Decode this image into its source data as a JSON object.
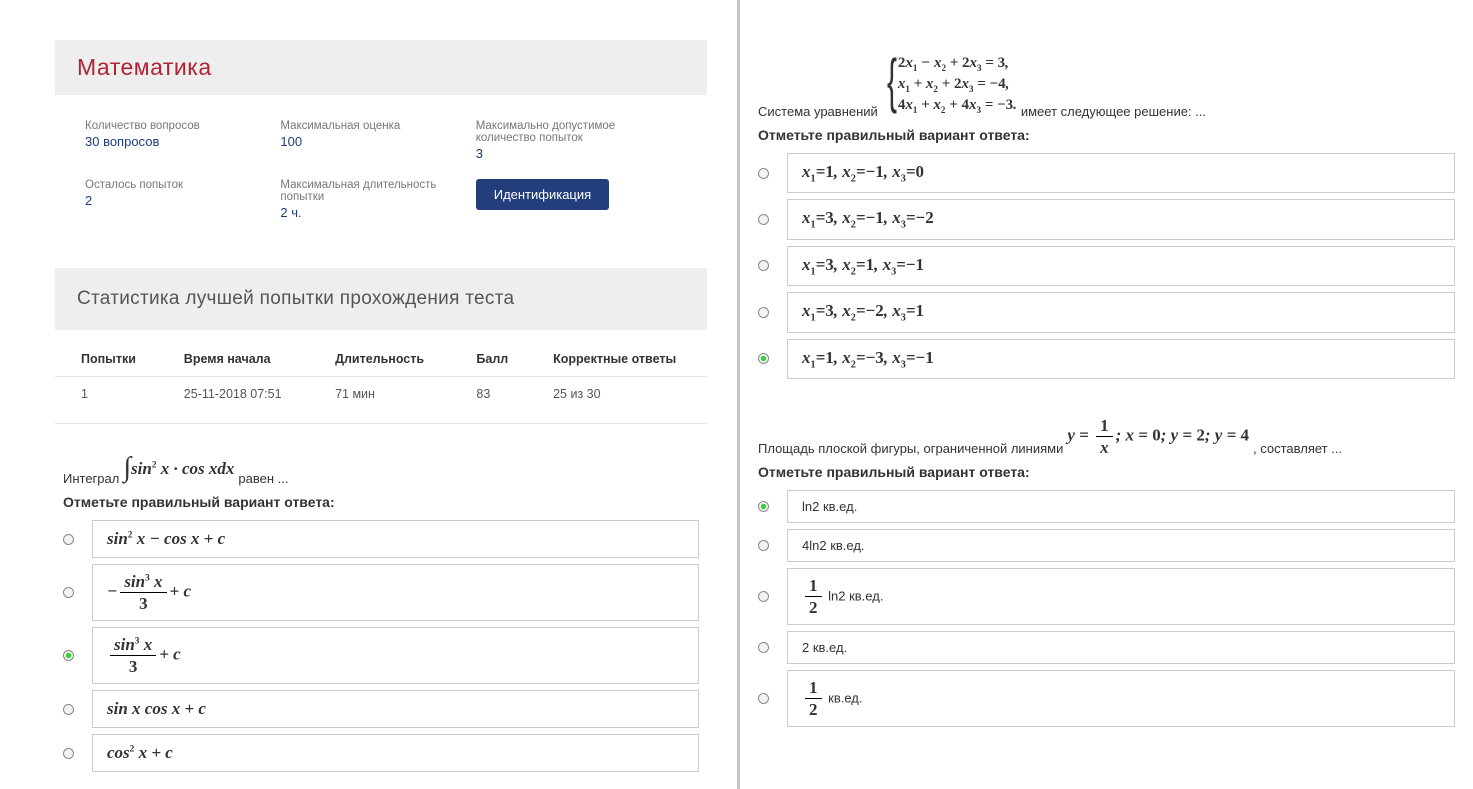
{
  "left": {
    "title": "Математика",
    "info": {
      "questions_label": "Количество вопросов",
      "questions_value": "30 вопросов",
      "maxscore_label": "Максимальная оценка",
      "maxscore_value": "100",
      "maxattempts_label": "Максимально допустимое количество попыток",
      "maxattempts_value": "3",
      "attemptsleft_label": "Осталось попыток",
      "attemptsleft_value": "2",
      "maxduration_label": "Максимальная длительность попытки",
      "maxduration_value": "2 ч.",
      "identify_btn": "Идентификация"
    },
    "stats_title": "Статистика лучшей попытки прохождения теста",
    "table": {
      "headers": [
        "Попытки",
        "Время начала",
        "Длительность",
        "Балл",
        "Корректные ответы"
      ],
      "row": [
        "1",
        "25-11-2018 07:51",
        "71 мин",
        "83",
        "25 из 30"
      ]
    },
    "q1": {
      "prefix": "Интеграл",
      "suffix": "равен ...",
      "instruction": "Отметьте правильный вариант ответа:",
      "selected": 2
    }
  },
  "right": {
    "q2": {
      "prefix": "Система уравнений",
      "suffix": "имеет следующее решение: ...",
      "instruction": "Отметьте правильный вариант ответа:",
      "selected": 4
    },
    "q3": {
      "prefix": "Площадь плоской фигуры, ограниченной линиями",
      "suffix": ", составляет ...",
      "instruction": "Отметьте правильный вариант ответа:",
      "options_plain": [
        "ln2 кв.ед.",
        "4ln2 кв.ед.",
        "ln2 кв.ед.",
        "2 кв.ед.",
        "кв.ед."
      ],
      "selected": 0
    }
  },
  "chart_data": {
    "type": "table",
    "title": "Статистика лучшей попытки прохождения теста",
    "categories": [
      "Попытки",
      "Время начала",
      "Длительность",
      "Балл",
      "Корректные ответы"
    ],
    "values": [
      [
        "1",
        "25-11-2018 07:51",
        "71 мин",
        "83",
        "25 из 30"
      ]
    ]
  }
}
